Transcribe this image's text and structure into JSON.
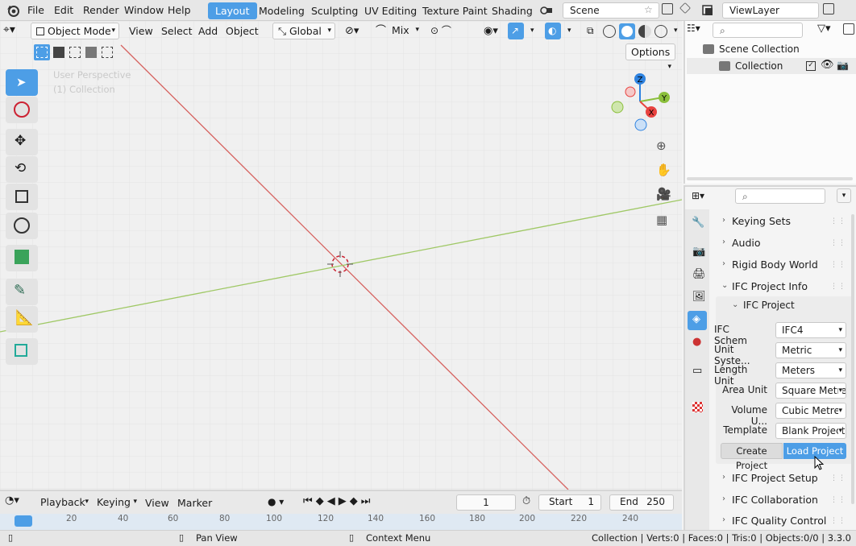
{
  "menus": [
    "File",
    "Edit",
    "Render",
    "Window",
    "Help"
  ],
  "workspaces": [
    {
      "label": "Layout",
      "active": true
    },
    {
      "label": "Modeling",
      "active": false
    },
    {
      "label": "Sculpting",
      "active": false
    },
    {
      "label": "UV Editing",
      "active": false
    },
    {
      "label": "Texture Paint",
      "active": false
    },
    {
      "label": "Shading",
      "active": false
    }
  ],
  "scene_name": "Scene",
  "view_layer": "ViewLayer",
  "viewport": {
    "mode": "Object Mode",
    "menus": [
      "View",
      "Select",
      "Add",
      "Object"
    ],
    "transform_orientation": "Global",
    "snap_mode": "Mix",
    "options_label": "Options",
    "overlay_line1": "User Perspective",
    "overlay_line2": "(1) Collection",
    "gizmo_axes": [
      "Z",
      "Y",
      "X"
    ]
  },
  "outliner": {
    "scene_collection": "Scene Collection",
    "collection": "Collection"
  },
  "properties": {
    "sections": [
      "Keying Sets",
      "Audio",
      "Rigid Body World",
      "IFC Project Info"
    ],
    "subsection": "IFC Project",
    "fields": [
      {
        "label": "IFC Schem",
        "value": "IFC4"
      },
      {
        "label": "Unit Syste...",
        "value": "Metric"
      },
      {
        "label": "Length Unit",
        "value": "Meters"
      },
      {
        "label": "Area Unit",
        "value": "Square Metre"
      },
      {
        "label": "Volume U...",
        "value": "Cubic Metre"
      },
      {
        "label": "Template",
        "value": "Blank Project"
      }
    ],
    "create_button": "Create Project",
    "load_button": "Load Project",
    "sections_after": [
      "IFC Project Setup",
      "IFC Collaboration",
      "IFC Quality Control"
    ]
  },
  "timeline": {
    "menus": [
      "Playback",
      "Keying",
      "View",
      "Marker"
    ],
    "current_frame": "1",
    "start_label": "Start",
    "start_value": "1",
    "end_label": "End",
    "end_value": "250",
    "ruler": [
      "20",
      "40",
      "60",
      "80",
      "100",
      "120",
      "140",
      "160",
      "180",
      "200",
      "220",
      "240"
    ]
  },
  "statusbar": {
    "pan": "Pan View",
    "context": "Context Menu",
    "stats": "Collection | Verts:0 | Faces:0 | Tris:0 | Objects:0/0 | 3.3.0"
  },
  "colors": {
    "accent": "#4d9ee6",
    "x_axis": "#e8423f",
    "y_axis": "#8bbf3c",
    "z_axis": "#2f83e0"
  }
}
